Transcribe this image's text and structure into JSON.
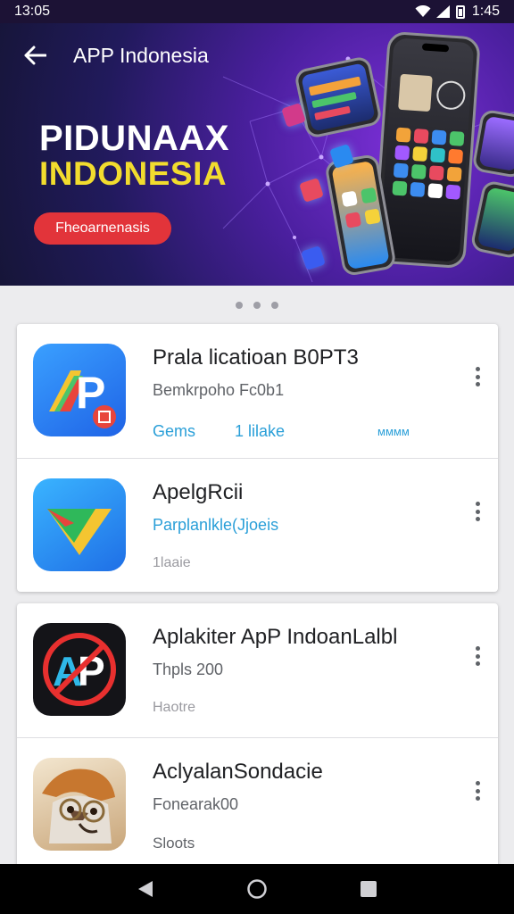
{
  "status_bar": {
    "time": "13:05",
    "right_time": "1:45"
  },
  "header": {
    "title": "APP Indonesia"
  },
  "banner": {
    "heading_line1": "PIDUNAAX",
    "heading_line2": "INDONESIA",
    "button_label": "Fheoarnenasis"
  },
  "carousel": {
    "page_count": 3
  },
  "apps": [
    {
      "title": "Prala licati­oan B0PT3",
      "subtitle": "Bemkrpoho Fc0b1",
      "tags": [
        "Gems",
        "1 lilake",
        "мммм"
      ],
      "icon": "ap-blue-icon"
    },
    {
      "title": "ApelgRcii",
      "subtitle": "Parplanlkle(Jjoeis",
      "meta": "1laaie",
      "icon": "green-triangle-icon"
    },
    {
      "title": "Aplakiter ApP IndoanLalbl",
      "subtitle": "Thpls 200",
      "meta": "Haotre",
      "icon": "ap-red-circle-icon"
    },
    {
      "title": "AclyalanSondacie",
      "subtitle": "Fonearak00",
      "meta": "Sloots",
      "icon": "raccoon-glasses-icon"
    }
  ],
  "colors": {
    "banner_button": "#e2343a",
    "heading_yellow": "#f2dc2e",
    "link_blue": "#2a9fd8"
  }
}
